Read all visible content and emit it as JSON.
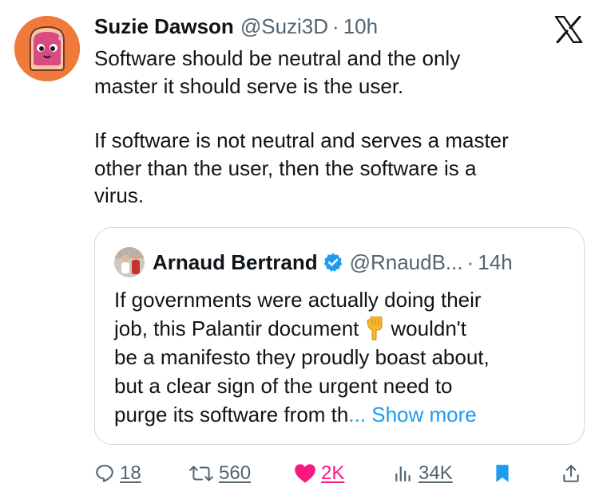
{
  "tweet": {
    "author_name": "Suzie Dawson",
    "author_handle": "@Suzi3D",
    "separator": "·",
    "time": "10h",
    "text_p1_l1": "Software should be neutral and the only",
    "text_p1_l2": "master it should serve is the user.",
    "text_p2_l1": "If software is not neutral and serves a master",
    "text_p2_l2": "other than the user, then the software is a",
    "text_p2_l3": "virus."
  },
  "quote": {
    "author_name": "Arnaud Bertrand",
    "author_handle": "@RnaudB...",
    "separator": "·",
    "time": "14h",
    "line1": "If governments were actually doing their",
    "line2_a": "job, this Palantir document",
    "line2_b": "wouldn't",
    "line3": "be a manifesto they proudly boast about,",
    "line4": "but a clear sign of the urgent need to",
    "line5": "purge its software from th",
    "show_more": "... Show more"
  },
  "actions": {
    "replies": "18",
    "retweets": "560",
    "likes": "2K",
    "views": "34K"
  },
  "icons": {
    "platform_logo": "x-logo-icon",
    "verified": "verified-badge-icon",
    "reply": "reply-icon",
    "retweet": "retweet-icon",
    "like": "heart-icon",
    "views": "views-icon",
    "bookmark": "bookmark-icon",
    "share": "share-icon",
    "emoji": "pointing-down-emoji"
  },
  "colors": {
    "accent": "#1d9bf0",
    "like": "#f91880",
    "muted": "#536471",
    "text": "#0f1419"
  }
}
